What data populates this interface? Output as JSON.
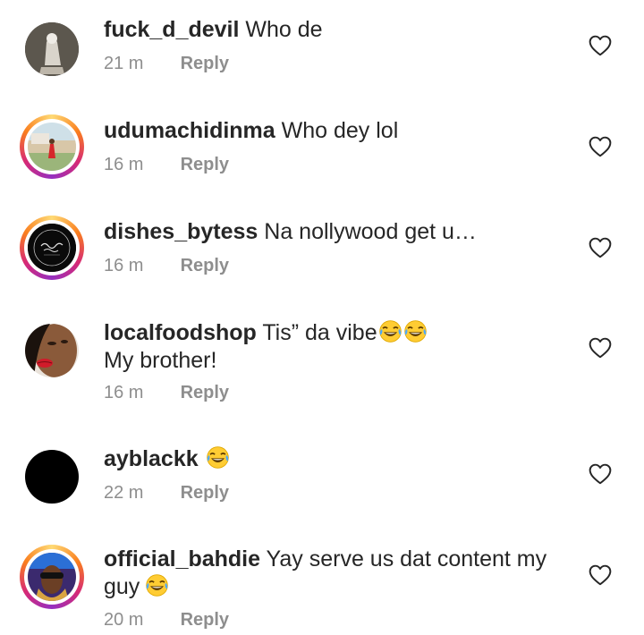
{
  "comments": [
    {
      "username": "fuck_d_devil",
      "text": "Who de",
      "time": "21 m",
      "reply": "Reply"
    },
    {
      "username": "udumachidinma",
      "text": "Who dey lol",
      "time": "16 m",
      "reply": "Reply"
    },
    {
      "username": "dishes_bytess",
      "text": "Na nollywood get u…",
      "time": "16 m",
      "reply": "Reply"
    },
    {
      "username": "localfoodshop",
      "text": "Tis” da vibe",
      "text_line2": "My brother!",
      "time": "16 m",
      "reply": "Reply"
    },
    {
      "username": "ayblackk",
      "text": "",
      "time": "22 m",
      "reply": "Reply"
    },
    {
      "username": "official_bahdie",
      "text": "Yay serve us dat content my",
      "text_line2": "guy",
      "time": "20 m",
      "reply": "Reply"
    }
  ],
  "icons": {
    "like": "heart-outline-icon",
    "emoji": "face-with-tears-of-joy-icon"
  },
  "colors": {
    "text": "#262626",
    "secondary": "#8e8e8e",
    "story_ring": [
      "#feda75",
      "#fa7e1e",
      "#d62976",
      "#962fbf"
    ]
  }
}
